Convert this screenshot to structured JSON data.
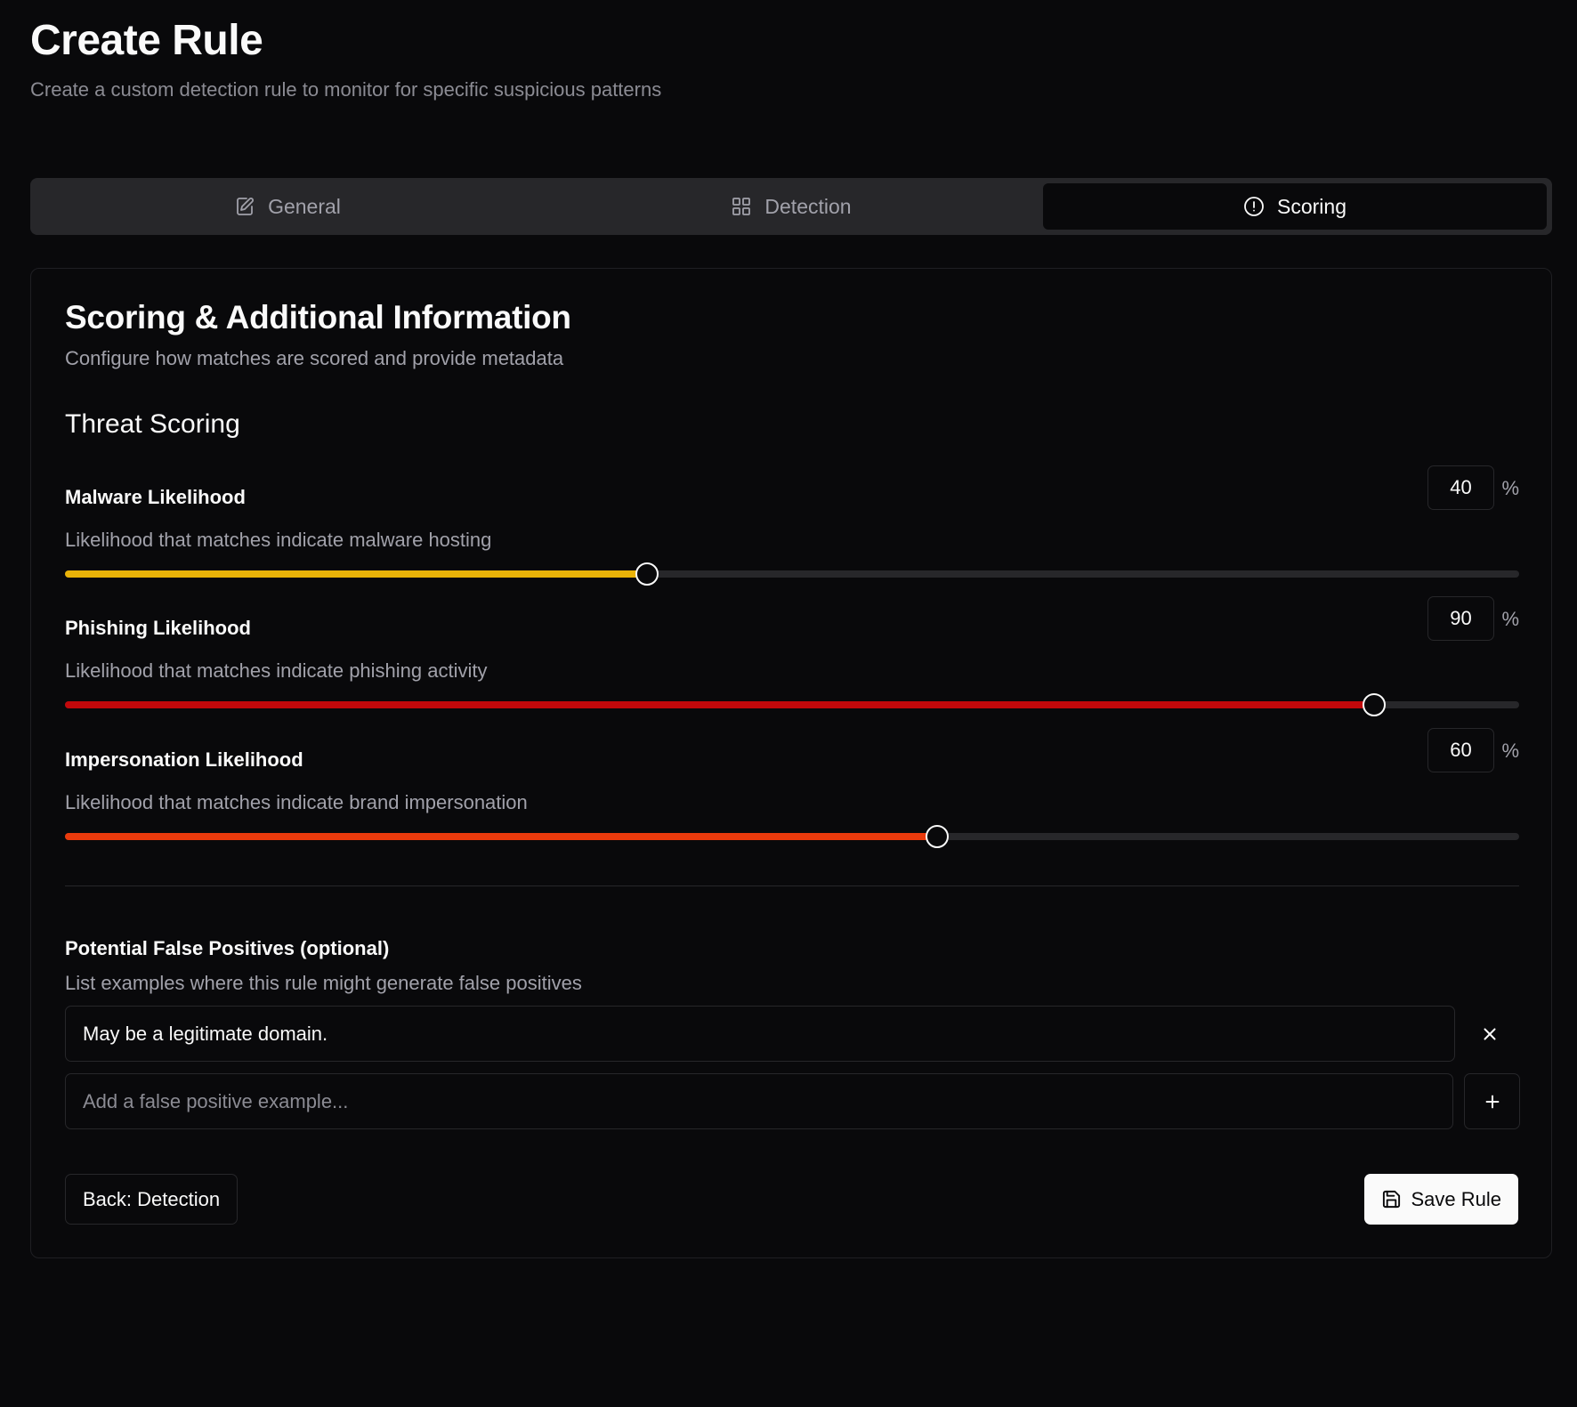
{
  "header": {
    "title": "Create Rule",
    "subtitle": "Create a custom detection rule to monitor for specific suspicious patterns"
  },
  "tabs": [
    {
      "label": "General",
      "icon": "edit-icon",
      "active": false
    },
    {
      "label": "Detection",
      "icon": "grid-icon",
      "active": false
    },
    {
      "label": "Scoring",
      "icon": "alert-circle-icon",
      "active": true
    }
  ],
  "card": {
    "title": "Scoring & Additional Information",
    "description": "Configure how matches are scored and provide metadata"
  },
  "threat_scoring": {
    "title": "Threat Scoring",
    "sliders": [
      {
        "label": "Malware Likelihood",
        "help": "Likelihood that matches indicate malware hosting",
        "value": "40",
        "unit": "%",
        "color": "#eab308"
      },
      {
        "label": "Phishing Likelihood",
        "help": "Likelihood that matches indicate phishing activity",
        "value": "90",
        "unit": "%",
        "color": "#c1080b"
      },
      {
        "label": "Impersonation Likelihood",
        "help": "Likelihood that matches indicate brand impersonation",
        "value": "60",
        "unit": "%",
        "color": "#ea3a0c"
      }
    ]
  },
  "false_positives": {
    "title": "Potential False Positives (optional)",
    "description": "List examples where this rule might generate false positives",
    "items": [
      "May be a legitimate domain."
    ],
    "input_placeholder": "Add a false positive example..."
  },
  "footer": {
    "back_label": "Back: Detection",
    "save_label": "Save Rule"
  }
}
